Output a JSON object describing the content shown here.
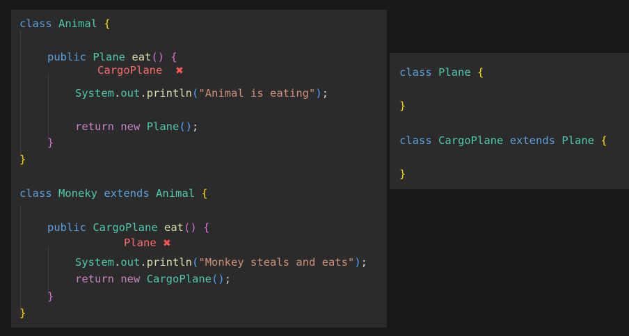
{
  "left_panel": {
    "animal_class": {
      "kw_class": "class",
      "name": "Animal",
      "open": "{",
      "close": "}"
    },
    "animal_method": {
      "kw_public": "public",
      "return_type": "Plane",
      "name": "eat",
      "parens": "()",
      "open": "{",
      "close": "}",
      "annotation": "CargoPlane",
      "annotation_mark": "✖",
      "print_obj": "System",
      "print_dot1": ".",
      "print_out": "out",
      "print_dot2": ".",
      "print_fn": "println",
      "print_open": "(",
      "print_str": "\"Animal is eating\"",
      "print_close": ")",
      "semi": ";",
      "kw_return": "return",
      "kw_new": "new",
      "new_type": "Plane",
      "new_parens": "()",
      "new_semi": ";"
    },
    "monkey_class": {
      "kw_class": "class",
      "name": "Moneky",
      "kw_extends": "extends",
      "parent": "Animal",
      "open": "{",
      "close": "}"
    },
    "monkey_method": {
      "kw_public": "public",
      "return_type": "CargoPlane",
      "name": "eat",
      "parens": "()",
      "open": "{",
      "close": "}",
      "annotation": "Plane",
      "annotation_mark": "✖",
      "print_obj": "System",
      "print_dot1": ".",
      "print_out": "out",
      "print_dot2": ".",
      "print_fn": "println",
      "print_open": "(",
      "print_str": "\"Monkey steals and eats\"",
      "print_close": ")",
      "semi": ";",
      "kw_return": "return",
      "kw_new": "new",
      "new_type": "CargoPlane",
      "new_parens": "()",
      "new_semi": ";"
    }
  },
  "right_panel": {
    "plane_class": {
      "kw_class": "class",
      "name": "Plane",
      "open": "{",
      "close": "}"
    },
    "cargo_class": {
      "kw_class": "class",
      "name": "CargoPlane",
      "kw_extends": "extends",
      "parent": "Plane",
      "open": "{",
      "close": "}"
    }
  },
  "colors": {
    "background": "#181818",
    "panel": "#2b2b2b",
    "keyword": "#5aa0dc",
    "type": "#4ec9b0",
    "brace": "#ffd700",
    "method": "#dcdcaa",
    "string": "#ce9178",
    "control": "#c586c0",
    "annotation": "#ff6b6b"
  }
}
